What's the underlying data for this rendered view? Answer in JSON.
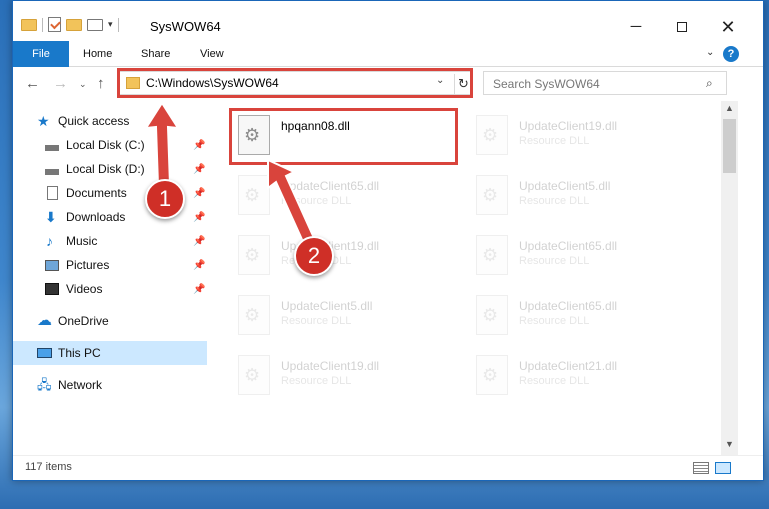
{
  "window": {
    "title": "SysWOW64",
    "controls": {
      "minimize": "─",
      "maximize": "",
      "close": "✕"
    }
  },
  "quick_access_toolbar": {
    "dropdown": "▾"
  },
  "ribbon": {
    "tabs": [
      "File",
      "Home",
      "Share",
      "View"
    ],
    "expand": "⌄",
    "help": "?"
  },
  "nav": {
    "back": "←",
    "forward": "→",
    "recent": "⌄",
    "up": "↑"
  },
  "address": {
    "path": "C:\\Windows\\SysWOW64",
    "dropdown": "⌄",
    "refresh": "↻"
  },
  "search": {
    "placeholder": "Search SysWOW64",
    "icon": "⌕"
  },
  "sidebar": {
    "items": [
      {
        "label": "Quick access",
        "icon": "star-icon",
        "pinned": false
      },
      {
        "label": "Local Disk (C:)",
        "icon": "drive-icon",
        "pinned": true
      },
      {
        "label": "Local Disk (D:)",
        "icon": "drive-icon",
        "pinned": true
      },
      {
        "label": "Documents",
        "icon": "documents-icon",
        "pinned": true
      },
      {
        "label": "Downloads",
        "icon": "downloads-icon",
        "pinned": true
      },
      {
        "label": "Music",
        "icon": "music-icon",
        "pinned": true
      },
      {
        "label": "Pictures",
        "icon": "pictures-icon",
        "pinned": true
      },
      {
        "label": "Videos",
        "icon": "videos-icon",
        "pinned": true
      },
      {
        "label": "OneDrive",
        "icon": "onedrive-icon",
        "pinned": false
      },
      {
        "label": "This PC",
        "icon": "this-pc-icon",
        "pinned": false,
        "selected": true
      },
      {
        "label": "Network",
        "icon": "network-icon",
        "pinned": false
      }
    ],
    "pin_glyph": "📌"
  },
  "files": [
    {
      "name": "hpqann08.dll",
      "type": ""
    },
    {
      "name": "UpdateClient19.dll",
      "type": "Resource DLL"
    },
    {
      "name": "UpdateClient65.dll",
      "type": "Resource DLL"
    },
    {
      "name": "UpdateClient5.dll",
      "type": "Resource DLL"
    },
    {
      "name": "UpdateClient19.dll",
      "type": "Resource DLL"
    },
    {
      "name": "UpdateClient65.dll",
      "type": "Resource DLL"
    },
    {
      "name": "UpdateClient5.dll",
      "type": "Resource DLL"
    },
    {
      "name": "UpdateClient65.dll",
      "type": "Resource DLL"
    },
    {
      "name": "UpdateClient19.dll",
      "type": "Resource DLL"
    },
    {
      "name": "UpdateClient21.dll",
      "type": "Resource DLL"
    }
  ],
  "annotations": {
    "step1": "1",
    "step2": "2"
  },
  "status": {
    "item_count": "117 items"
  },
  "scrollbar": {
    "up": "▲",
    "down": "▼"
  },
  "colors": {
    "accent": "#1979ca",
    "highlight": "#d9443c",
    "selected": "#cce8ff"
  }
}
